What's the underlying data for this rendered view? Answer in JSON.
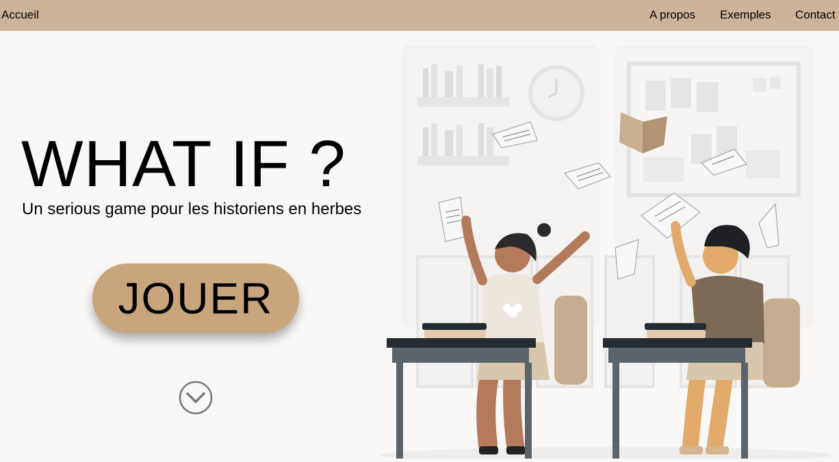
{
  "nav": {
    "home": "Accueil",
    "about": "A propos",
    "examples": "Exemples",
    "contact": "Contact"
  },
  "hero": {
    "title": "WHAT IF ?",
    "subtitle": "Un serious game pour les historiens en herbes",
    "play_label": "JOUER",
    "scroll_icon": "chevron-down-circle-icon"
  },
  "colors": {
    "navbar": "#ccb498",
    "button": "#c8a57c",
    "background": "#f9f8f7"
  },
  "illustration": {
    "subject": "classroom-students-throwing-papers"
  }
}
